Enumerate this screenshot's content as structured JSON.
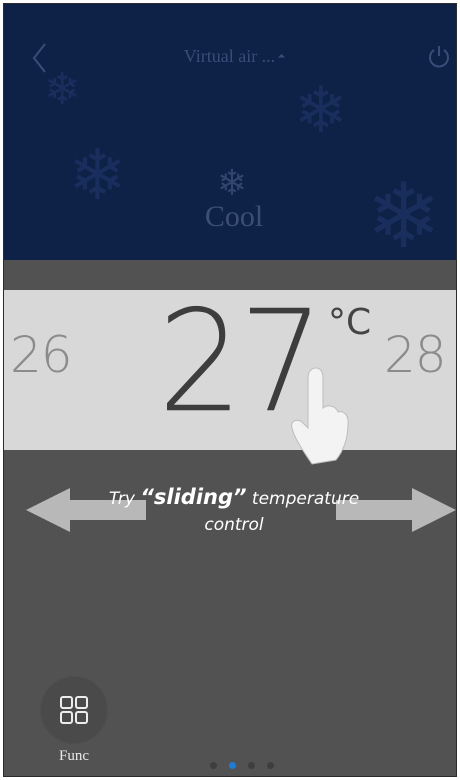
{
  "header": {
    "title": "Virtual air ...",
    "mode_label": "Cool"
  },
  "temperature": {
    "current": "27",
    "unit": "°C",
    "prev": "26",
    "next": "28"
  },
  "hint": {
    "line1_prefix": "Try ",
    "line1_highlight": "“sliding”",
    "line1_suffix": " temperature",
    "line2": "control"
  },
  "footer": {
    "func_label": "Func",
    "pager": {
      "total": 4,
      "active_index": 1
    }
  },
  "icons": {
    "back": "chevron-left-icon",
    "power": "power-icon",
    "mode": "snowflake-icon",
    "func": "grid-icon",
    "hand": "pointing-hand-icon"
  },
  "colors": {
    "header_bg": "#0e2146",
    "band_bg": "#d8d8d8",
    "body_bg": "#525252",
    "active_dot": "#1e7cd6"
  }
}
